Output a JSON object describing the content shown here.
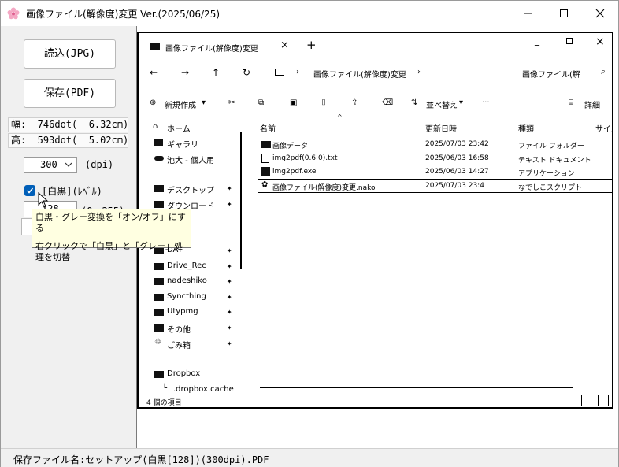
{
  "window": {
    "title": "画像ファイル(解像度)変更 Ver.(2025/06/25)"
  },
  "left_panel": {
    "read_button": "読込(JPG)",
    "save_button": "保存(PDF)",
    "width_row": "幅:  746dot(  6.32cm)",
    "height_row": "高:  593dot(  5.02cm)",
    "dpi_value": "300",
    "dpi_unit": "(dpi)",
    "mono_label": "[白黒](ﾚﾍﾞﾙ)",
    "level_value": "128",
    "level_range": "(0～255)"
  },
  "tooltip": {
    "line1": "白黒・グレー変換を「オン/オフ」にする",
    "line2": "右クリックで「白黒」と「グレー」処理を切替"
  },
  "preview": {
    "tab_title": "画像ファイル(解像度)変更",
    "address": "画像ファイル(解像度)変更",
    "search": "画像ファイル(解",
    "new_button": "新規作成",
    "sort_button": "並べ替え",
    "details_button": "詳細",
    "col_name": "名前",
    "col_date": "更新日時",
    "col_type": "種類",
    "col_size": "サイズ",
    "nav": {
      "home": "ホーム",
      "gallery": "ギャラリ",
      "onedrive": "池大 - 個人用",
      "desktop": "デスクトップ",
      "downloads": "ダウンロード",
      "dat": "DAT",
      "drive_rec": "Drive_Rec",
      "nodeshiko": "nadeshiko",
      "syncthing": "Syncthing",
      "utypmg": "Utypmg",
      "other": "その他",
      "trash": "ごみ箱",
      "dropbox": "Dropbox",
      "dropbox_cache": ".dropbox.cache"
    },
    "files": [
      {
        "name": "画像データ",
        "date": "2025/07/03 23:42",
        "type": "ファイル フォルダー"
      },
      {
        "name": "img2pdf(0.6.0).txt",
        "date": "2025/06/03 16:58",
        "type": "テキスト ドキュメント"
      },
      {
        "name": "img2pdf.exe",
        "date": "2025/06/03 14:27",
        "type": "アプリケーション"
      },
      {
        "name": "画像ファイル(解像度)変更.nako",
        "date": "2025/07/03 23:4",
        "type": "なでしこスクリプト"
      }
    ],
    "item_count": "4 個の項目"
  },
  "status": {
    "text": "保存ファイル名:セットアップ(白黒[128])(300dpi).PDF"
  }
}
